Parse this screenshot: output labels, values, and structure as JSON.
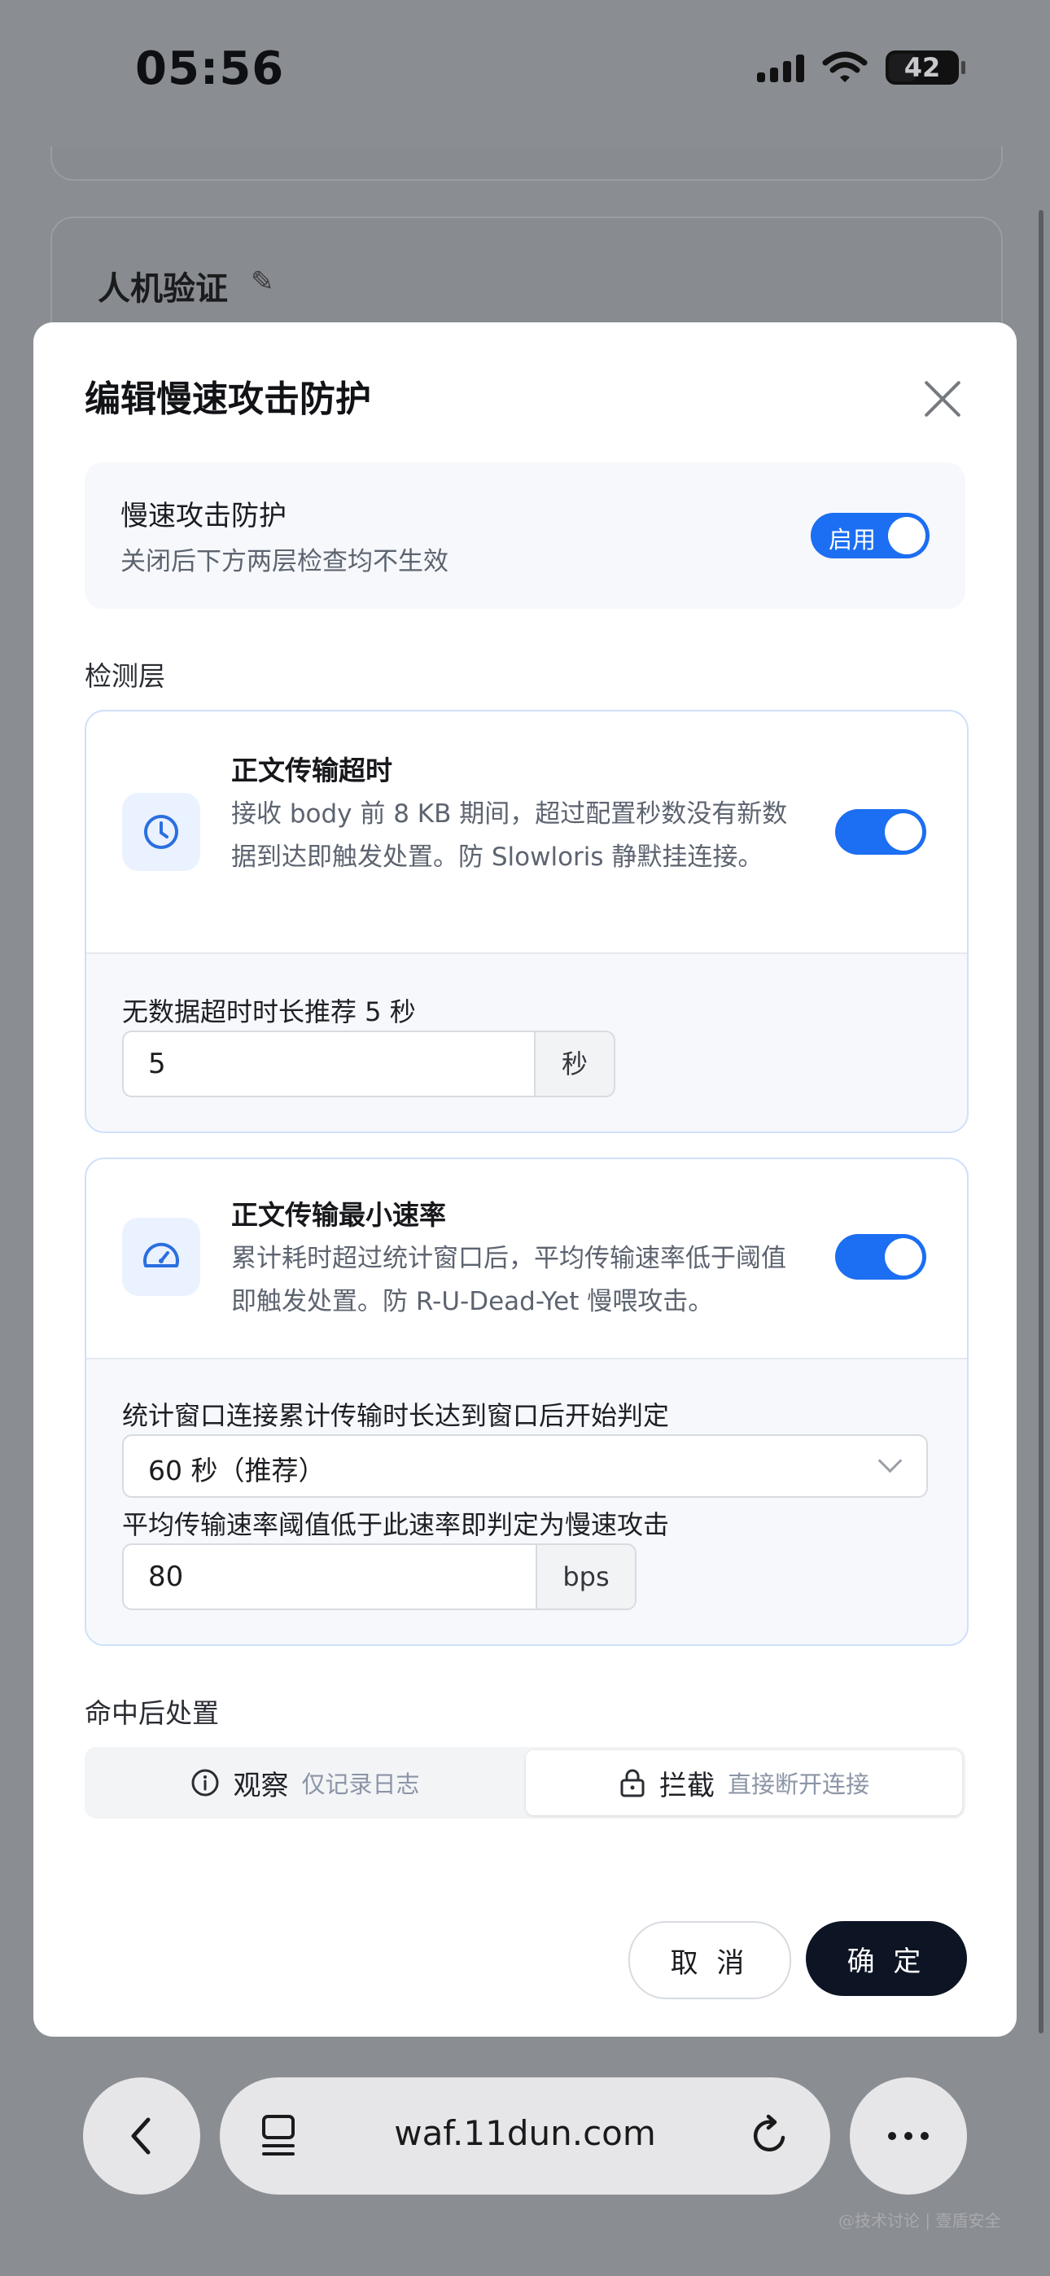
{
  "status_bar": {
    "time": "05:56",
    "battery": "42",
    "icons": [
      "cellular-signal-icon",
      "wifi-icon",
      "battery-icon"
    ]
  },
  "background_page": {
    "card_title": "人机验证"
  },
  "modal": {
    "title": "编辑慢速攻击防护",
    "master_switch": {
      "title": "慢速攻击防护",
      "description": "关闭后下方两层检查均不生效",
      "toggle_label": "启用",
      "enabled": true
    },
    "section_label": "检测层",
    "layers": [
      {
        "title": "正文传输超时",
        "description": "接收 body 前 8 KB 期间，超过配置秒数没有新数据到达即触发处置。防 Slowloris 静默挂连接。",
        "enabled": true,
        "icon": "clock-icon",
        "field_label": "无数据超时时长推荐 5 秒",
        "field_value": "5",
        "field_unit": "秒"
      },
      {
        "title": "正文传输最小速率",
        "description": "累计耗时超过统计窗口后，平均传输速率低于阈值即触发处置。防 R-U-Dead-Yet 慢喂攻击。",
        "enabled": true,
        "icon": "speedometer-icon",
        "window_label": "统计窗口连接累计传输时长达到窗口后开始判定",
        "window_value": "60 秒（推荐）",
        "rate_label": "平均传输速率阈值低于此速率即判定为慢速攻击",
        "rate_value": "80",
        "rate_unit": "bps"
      }
    ],
    "action_label": "命中后处置",
    "actions": [
      {
        "label": "观察",
        "hint": "仅记录日志",
        "icon": "info-icon",
        "selected": false
      },
      {
        "label": "拦截",
        "hint": "直接断开连接",
        "icon": "lock-icon",
        "selected": true
      }
    ],
    "cancel_label": "取 消",
    "confirm_label": "确 定"
  },
  "browser": {
    "url": "waf.11dun.com"
  },
  "watermark": "@技术讨论 | 壹盾安全",
  "colors": {
    "accent": "#1c6ef2",
    "primary_button": "#0d1424",
    "overlay": "#8a8d92"
  }
}
